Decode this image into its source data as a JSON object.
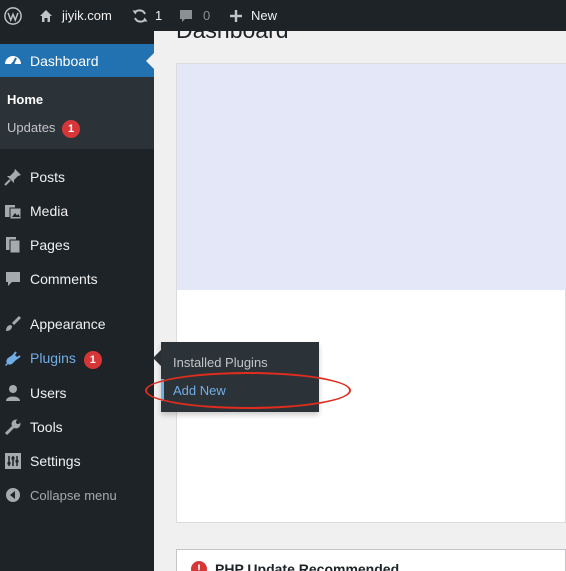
{
  "adminbar": {
    "site_name": "jiyik.com",
    "updates_count": "1",
    "comments_count": "0",
    "new_label": "New"
  },
  "sidebar": {
    "dashboard_label": "Dashboard",
    "submenu": {
      "home": "Home",
      "updates": "Updates",
      "updates_badge": "1"
    },
    "items": [
      {
        "label": "Posts",
        "icon": "pin-icon"
      },
      {
        "label": "Media",
        "icon": "media-icon"
      },
      {
        "label": "Pages",
        "icon": "pages-icon"
      },
      {
        "label": "Comments",
        "icon": "comment-icon"
      },
      {
        "label": "Appearance",
        "icon": "brush-icon"
      },
      {
        "label": "Plugins",
        "icon": "plugin-icon",
        "badge": "1"
      },
      {
        "label": "Users",
        "icon": "user-icon"
      },
      {
        "label": "Tools",
        "icon": "wrench-icon"
      },
      {
        "label": "Settings",
        "icon": "settings-icon"
      }
    ],
    "collapse_label": "Collapse menu"
  },
  "flyout": {
    "installed_plugins": "Installed Plugins",
    "add_new": "Add New"
  },
  "main": {
    "page_title": "Dashboard",
    "notice_title": "PHP Update Recommended"
  },
  "colors": {
    "adminbar_bg": "#1d2327",
    "accent": "#2271b1",
    "link_active": "#72aee6",
    "badge": "#d63638",
    "annotation": "#e02d1e"
  }
}
